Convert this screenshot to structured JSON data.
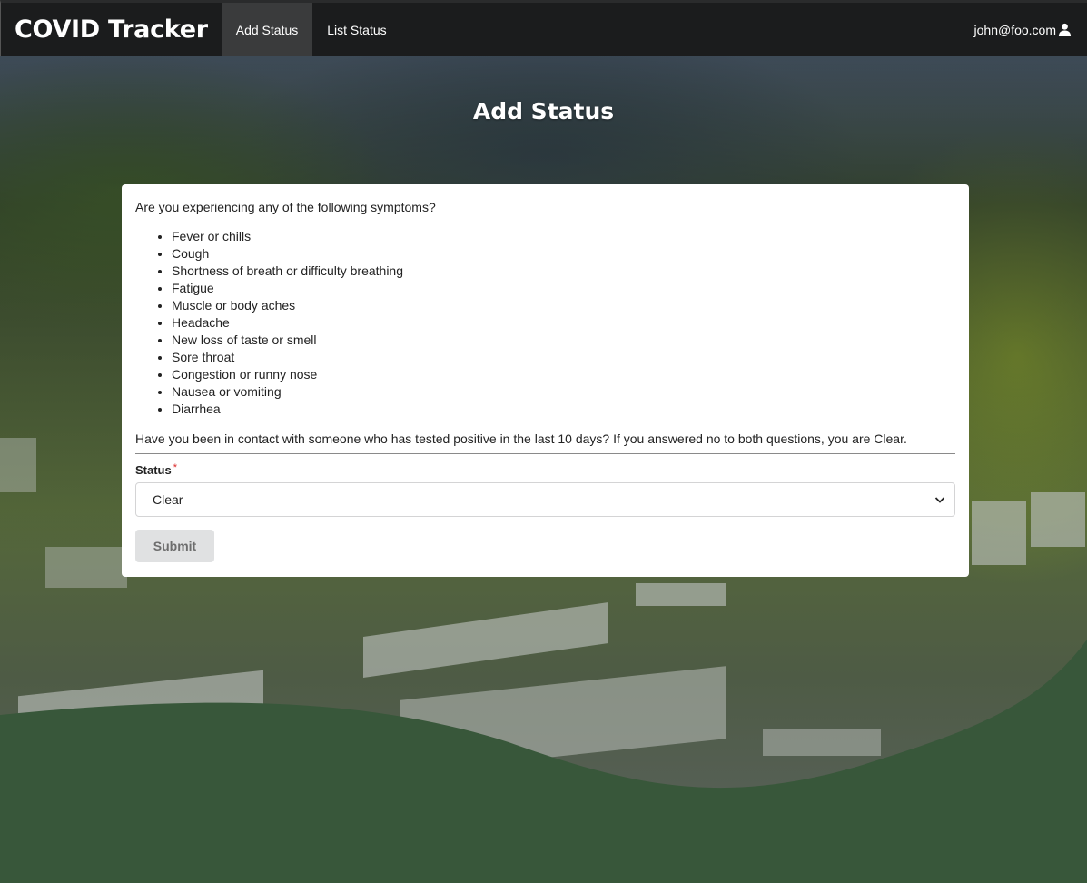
{
  "navbar": {
    "brand": "COVID Tracker",
    "items": [
      {
        "label": "Add Status",
        "active": true
      },
      {
        "label": "List Status",
        "active": false
      }
    ],
    "user_email": "john@foo.com",
    "user_icon": "user-icon"
  },
  "page": {
    "title": "Add Status"
  },
  "form": {
    "symptom_question": "Are you experiencing any of the following symptoms?",
    "symptoms": [
      "Fever or chills",
      "Cough",
      "Shortness of breath or difficulty breathing",
      "Fatigue",
      "Muscle or body aches",
      "Headache",
      "New loss of taste or smell",
      "Sore throat",
      "Congestion or runny nose",
      "Nausea or vomiting",
      "Diarrhea"
    ],
    "contact_question": "Have you been in contact with someone who has tested positive in the last 10 days? If you answered no to both questions, you are Clear.",
    "status_label": "Status",
    "required_marker": "*",
    "status_value": "Clear",
    "submit_label": "Submit"
  },
  "colors": {
    "navbar_bg": "#1b1c1d",
    "wave_green": "#38573a",
    "required_red": "#db2828"
  }
}
